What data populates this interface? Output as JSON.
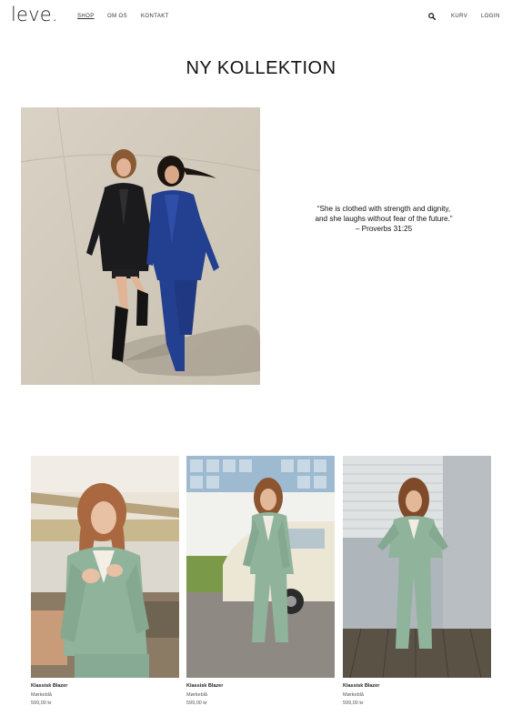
{
  "header": {
    "logo": "leve.",
    "nav": [
      {
        "label": "SHOP"
      },
      {
        "label": "OM OS"
      },
      {
        "label": "KONTAKT"
      }
    ],
    "cart_label": "KURV",
    "login_label": "LOGIN",
    "search_icon": "search-icon"
  },
  "main": {
    "title": "NY KOLLEKTION",
    "quote": {
      "line1": "“She is clothed with strength and dignity,",
      "line2": "and she laughs without fear of the future.”",
      "line3": "– Proverbs 31:25"
    }
  },
  "products": [
    {
      "name": "Klassisk Blazer",
      "color": "Mørkeblå",
      "price": "599,00 kr"
    },
    {
      "name": "Klassisk Blazer",
      "color": "Mørkeblå",
      "price": "599,00 kr"
    },
    {
      "name": "Klassisk Blazer",
      "color": "Mørkeblå",
      "price": "599,00 kr"
    }
  ],
  "colors": {
    "sage_green": "#8fb39b",
    "navy_blue": "#233f8f",
    "pavement": "#cfc7b8"
  }
}
